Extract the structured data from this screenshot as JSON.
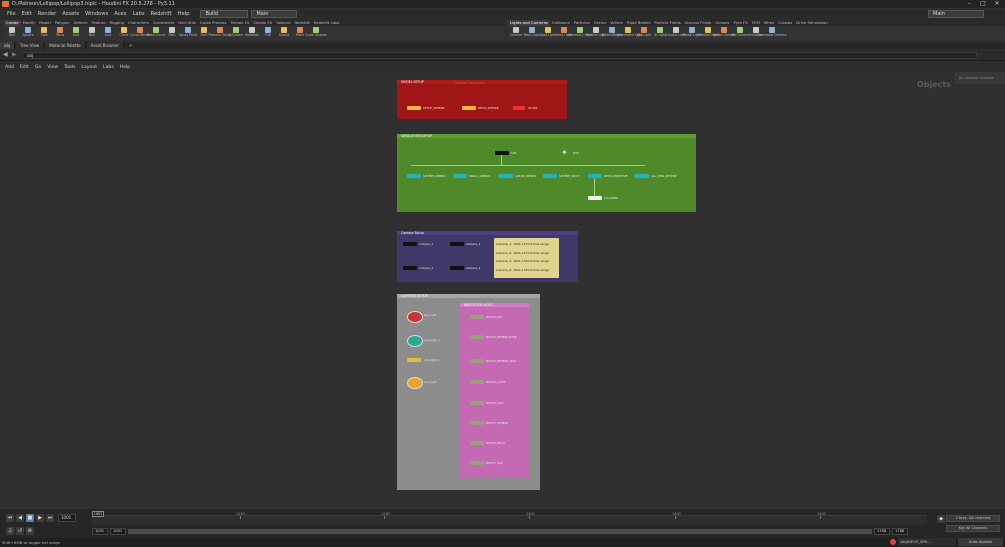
{
  "window": {
    "title": "D:/Patreon/Lollipop/Lollipop3.hiplc - Houdini FX 20.5.278 - Py3.11",
    "minimize": "–",
    "maximize": "□",
    "close": "✕"
  },
  "menubar": {
    "items": [
      "File",
      "Edit",
      "Render",
      "Assets",
      "Windows",
      "Aces",
      "Labs",
      "Redshift",
      "Help"
    ],
    "desktop": "Build",
    "context": "Main",
    "right_context": "Main"
  },
  "shelf_left": {
    "tabs": [
      "Create",
      "Modify",
      "Model",
      "Polygon",
      "Deform",
      "Texture",
      "Rigging",
      "Characters",
      "Constraints",
      "Hair Utils",
      "Guide Process",
      "Terrain FX",
      "Simple FX",
      "Volume",
      "Redshift",
      "Redshift Labs"
    ],
    "tools": [
      "Box",
      "Sphere",
      "Tube",
      "Torus",
      "Grid",
      "Null",
      "Line",
      "Circle",
      "Curve Bezier",
      "Draw Curve",
      "Path",
      "Spray Paint",
      "Font",
      "Platonic Solids",
      "L-System",
      "Metaball",
      "File",
      "Sprout",
      "Helix",
      "Quick Shapes"
    ]
  },
  "shelf_right": {
    "tabs": [
      "Lights and Cameras",
      "Collisions",
      "Particles",
      "Grains",
      "Vellum",
      "Rigid Bodies",
      "Particle Fluids",
      "Viscous Fluids",
      "Oceans",
      "Pyro FX",
      "FEM",
      "Wires",
      "Crowds",
      "Drive Simulation"
    ],
    "tools": [
      "Camera",
      "Point Light",
      "Spot Light",
      "Area Light",
      "Geometry Light",
      "Volume Light",
      "Distant Light",
      "Environment Light",
      "Sky Light",
      "GI Light",
      "Caustic Light",
      "Portal Light",
      "Ambient Light",
      "Stereo Camera",
      "VR Camera",
      "Switcher",
      "Gamepad Camera"
    ]
  },
  "pane_tabs": [
    "obj",
    "Tree View",
    "Material Palette",
    "Asset Browser"
  ],
  "path": "obj",
  "network_menu": [
    "Add",
    "Edit",
    "Go",
    "View",
    "Tools",
    "Layout",
    "Labs",
    "Help"
  ],
  "network": {
    "context_label": "Objects",
    "op_panel": "No Operator Selected",
    "boxes": {
      "model_setup": {
        "title": "MODEL SETUP",
        "subtitle": "Render Geometry",
        "nodes": [
          "SETUP_SPHERE",
          "DECO_SPHERE",
          "STORE"
        ]
      },
      "simulation_setup": {
        "title": "SIMULATION SETUP",
        "nodes": [
          "SIM",
          "DOP",
          "SPHERE_DEBRIS",
          "SMALL_DEBRIS",
          "LARGE_DEBRIS",
          "SPHERE_SPLIT",
          "DECO_PRIMITIVE",
          "ALL_SIMS_SPHERE",
          "COLLIDER"
        ]
      },
      "camera_setup": {
        "title": "Camera Setup",
        "nodes": [
          "Camera_1",
          "Camera_2",
          "Camera_3",
          "Camera_4"
        ],
        "notes": [
          "Camera_1: 1001-1170 frame range",
          "Camera_2: 1001-1170 frame range",
          "Camera_3: 1001-1300 frame range",
          "Camera_4: 1001-1330 frame range"
        ]
      },
      "lighting_setup": {
        "title": "LIGHTING SETUP",
        "lights": [
          "key_light",
          "env_light_1",
          "rim_light_2",
          "sun_light"
        ],
        "inner_title": "MATCH FOR LIGHT",
        "match_nodes": [
          "MATCH_KEY",
          "MATCH_SPHERE_BASE",
          "MATCH_SPHERE_WAX",
          "MATCH_LIGHT",
          "MATCH_WAX",
          "MATCH_SPHERE",
          "MATCH_DECO",
          "MATCH_CAP"
        ]
      }
    }
  },
  "timeline": {
    "current_frame": "1001",
    "start_frame": "1001",
    "end_frame": "1001",
    "range_start": "1788",
    "range_end": "1788",
    "ruler_ticks": [
      "1120",
      "1200",
      "1300",
      "1400",
      "1500",
      "1600"
    ],
    "keys_label": "0 keys, 0/0 channels",
    "key_all": "Key All Channels",
    "auto_update": "Auto Update",
    "status_obj": "/obj/DECO_SPH..."
  },
  "status": {
    "hint": "Shift+RMB to toggle full range"
  },
  "colors": {
    "model_box": "#a01515",
    "sim_box": "#4f8a2a",
    "camera_box": "#3f3868",
    "lighting_box": "#8c8c8c",
    "match_box": "#c46ab5"
  }
}
